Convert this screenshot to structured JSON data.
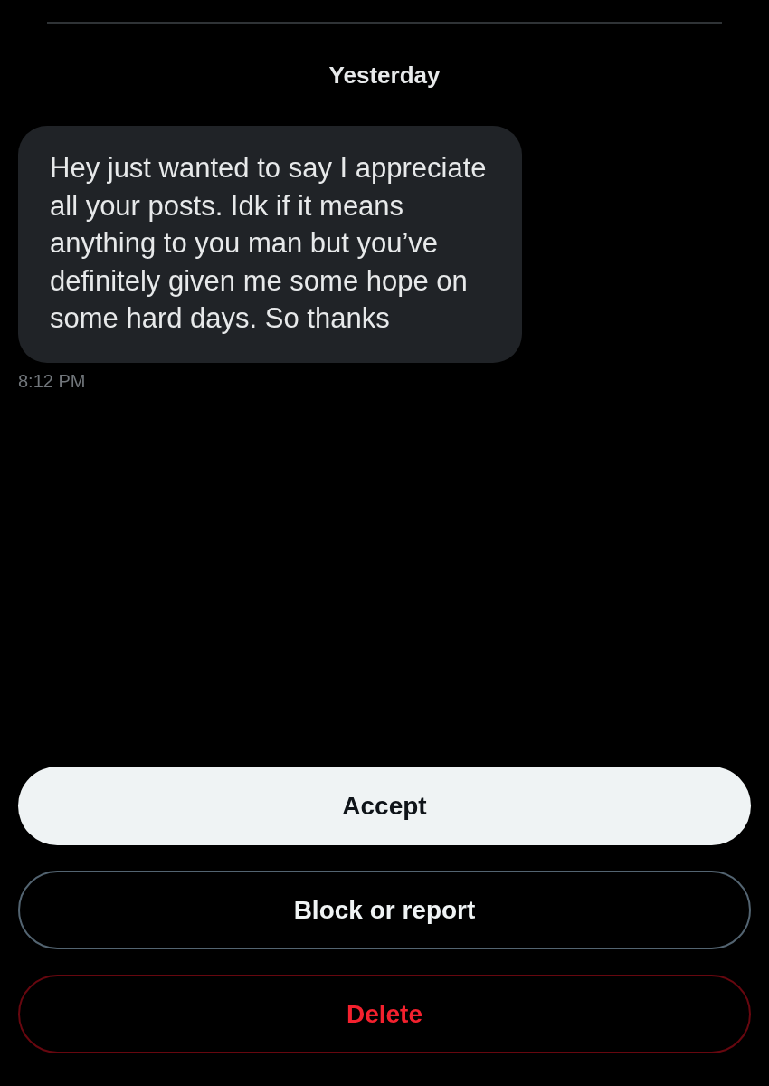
{
  "date_divider": "Yesterday",
  "messages": [
    {
      "text": "Hey just wanted to say I appreciate all your posts. Idk if it means anything to you man but you’ve definitely given me some hope on some hard days. So thanks",
      "time": "8:12 PM"
    }
  ],
  "actions": [
    {
      "label": "Accept",
      "kind": "primary"
    },
    {
      "label": "Block or report",
      "kind": "outline"
    },
    {
      "label": "Delete",
      "kind": "danger"
    }
  ]
}
